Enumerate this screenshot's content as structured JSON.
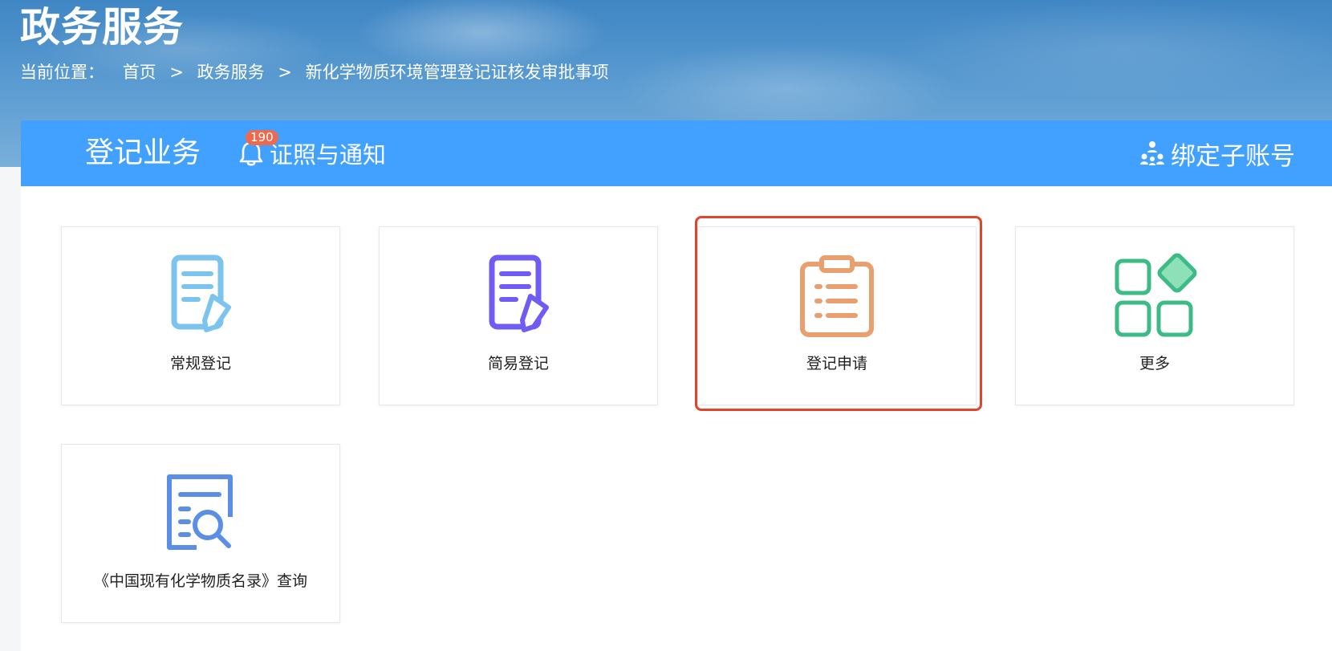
{
  "header": {
    "title": "政务服务",
    "breadcrumb_prefix": "当前位置：",
    "breadcrumb": [
      "首页",
      "政务服务",
      "新化学物质环境管理登记证核发审批事项"
    ],
    "breadcrumb_separator": ">"
  },
  "navbar": {
    "primary_tab": "登记业务",
    "notice_tab": "证照与通知",
    "notice_badge": "190",
    "bind_account": "绑定子账号",
    "background_color": "#42a0ff"
  },
  "services": [
    {
      "label": "常规登记",
      "icon": "document-edit-icon",
      "color": "#7cc3ee"
    },
    {
      "label": "简易登记",
      "icon": "document-edit-icon",
      "color": "#6f5cf2"
    },
    {
      "label": "登记申请",
      "icon": "clipboard-list-icon",
      "color": "#ea9f6e",
      "highlighted": true
    },
    {
      "label": "更多",
      "icon": "grid-more-icon",
      "color": "#3dbb86"
    },
    {
      "label": "《中国现有化学物质名录》查询",
      "icon": "document-search-icon",
      "color": "#5b8fe6"
    }
  ],
  "highlight_color": "#e0452c"
}
